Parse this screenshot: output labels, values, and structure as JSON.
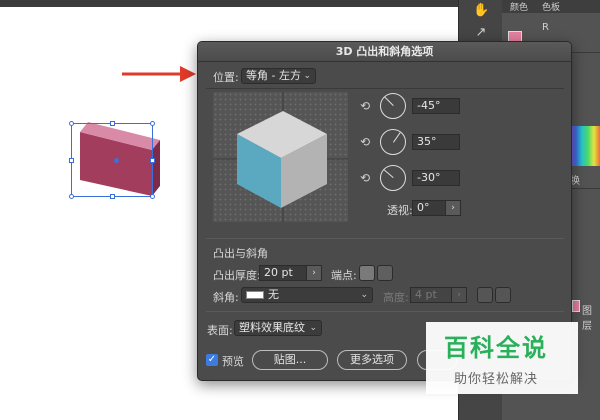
{
  "right_panel": {
    "tabs": [
      "颜色",
      "色板"
    ],
    "channel_label": "R",
    "labels": [
      "换",
      "图层"
    ]
  },
  "dialog": {
    "title": "3D 凸出和斜角选项",
    "position_label": "位置:",
    "position_value": "等角 - 左方",
    "rotation_x": "-45°",
    "rotation_y": "35°",
    "rotation_z": "-30°",
    "perspective_label": "透视:",
    "perspective_value": "0°",
    "extrude_section": "凸出与斜角",
    "extrude_depth_label": "凸出厚度:",
    "extrude_depth_value": "20 pt",
    "cap_label": "端点:",
    "bevel_label": "斜角:",
    "bevel_value": "无",
    "height_label": "高度:",
    "height_value": "4 pt",
    "surface_label": "表面:",
    "surface_value": "塑料效果底纹",
    "preview_label": "预览",
    "map_button": "贴图...",
    "more_options_button": "更多选项"
  },
  "watermark": {
    "title": "百科全说",
    "subtitle": "助你轻松解决"
  },
  "colors": {
    "cube_left": "#5aa9c0",
    "cube_top": "#d7d7d7",
    "cube_right": "#b3b3b3",
    "object_fill": "#b44a6a",
    "accent_blue": "#3b6fdc",
    "arrow_red": "#e03a2a",
    "watermark_green": "#29b05a"
  }
}
